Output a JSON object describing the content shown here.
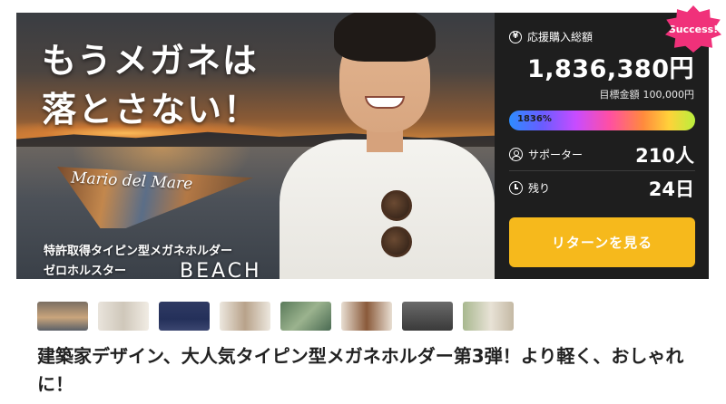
{
  "hero": {
    "headline_line1": "もうメガネは",
    "headline_line2": "落とさない！",
    "holder_text": "Mario del Mare",
    "subcopy_line1": "特許取得タイピン型メガネホルダー",
    "subcopy_line2": "ゼロホルスター",
    "brand": "BEACH"
  },
  "badge": {
    "label": "Success!"
  },
  "panel": {
    "total_label": "応援購入総額",
    "total_value": "1,836,380円",
    "goal_label": "目標金額",
    "goal_value": "100,000円",
    "progress_label": "1836%",
    "progress_fraction": 1.0,
    "supporters_label": "サポーター",
    "supporters_value": "210人",
    "remaining_label": "残り",
    "remaining_value": "24日",
    "cta_label": "リターンを見る",
    "icons": [
      "yen-icon",
      "user-icon",
      "clock-icon"
    ]
  },
  "thumbnails": [
    {
      "name": "thumbnail-1"
    },
    {
      "name": "thumbnail-2"
    },
    {
      "name": "thumbnail-3"
    },
    {
      "name": "thumbnail-4"
    },
    {
      "name": "thumbnail-5"
    },
    {
      "name": "thumbnail-6"
    },
    {
      "name": "thumbnail-7"
    },
    {
      "name": "thumbnail-8"
    }
  ],
  "project": {
    "title": "建築家デザイン、大人気タイピン型メガネホルダー第3弾！より軽く、おしゃれに！"
  },
  "colors": {
    "panel_bg": "#1e1e1e",
    "cta": "#f6b91c",
    "badge": "#f0317a"
  }
}
